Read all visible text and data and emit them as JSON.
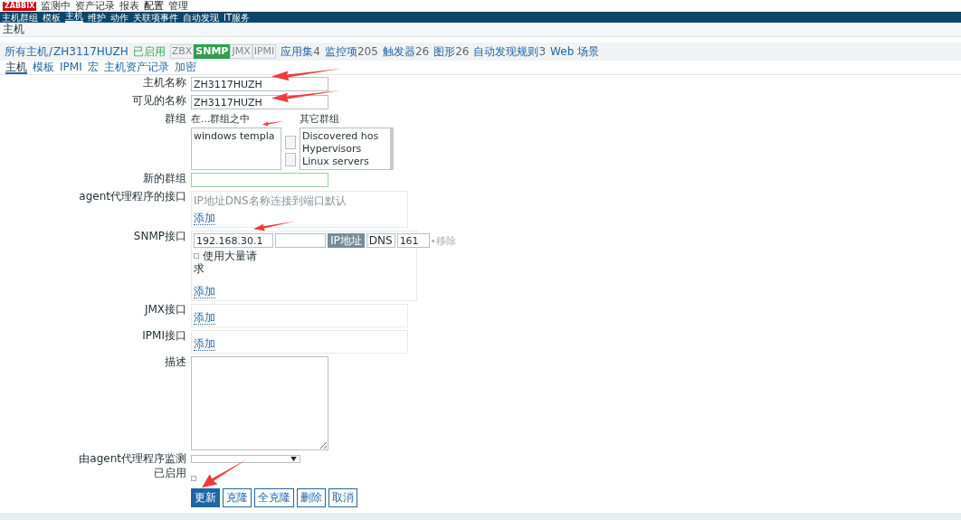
{
  "logo": "ZABBIX",
  "top_menu": [
    {
      "label": "监测中",
      "selected": false
    },
    {
      "label": "资产记录",
      "selected": false
    },
    {
      "label": "报表",
      "selected": false
    },
    {
      "label": "配置",
      "selected": true
    },
    {
      "label": "管理",
      "selected": false
    }
  ],
  "sub_menu": [
    {
      "label": "主机群组",
      "selected": false
    },
    {
      "label": "模板",
      "selected": false
    },
    {
      "label": "主机",
      "selected": true
    },
    {
      "label": "维护",
      "selected": false
    },
    {
      "label": "动作",
      "selected": false
    },
    {
      "label": "关联项事件",
      "selected": false
    },
    {
      "label": "自动发现",
      "selected": false
    },
    {
      "label": "IT服务",
      "selected": false
    }
  ],
  "page_title": "主机",
  "breadcrumb": {
    "all_hosts": "所有主机",
    "separator": "/",
    "host": "ZH3117HUZH",
    "status": "已启用",
    "availability": [
      {
        "label": "ZBX",
        "on": false
      },
      {
        "label": "SNMP",
        "on": true
      },
      {
        "label": "JMX",
        "on": false
      },
      {
        "label": "IPMI",
        "on": false
      }
    ],
    "links": [
      {
        "label": "应用集",
        "count": "4"
      },
      {
        "label": "监控项",
        "count": "205"
      },
      {
        "label": "触发器",
        "count": "26"
      },
      {
        "label": "图形",
        "count": "26"
      },
      {
        "label": "自动发现规则",
        "count": "3"
      },
      {
        "label": "Web 场景"
      }
    ]
  },
  "tabs": [
    {
      "label": "主机",
      "selected": true
    },
    {
      "label": "模板",
      "selected": false
    },
    {
      "label": "IPMI",
      "selected": false
    },
    {
      "label": "宏",
      "selected": false
    },
    {
      "label": "主机资产记录",
      "selected": false
    },
    {
      "label": "加密",
      "selected": false
    }
  ],
  "form": {
    "host_name": {
      "label": "主机名称",
      "value": "ZH3117HUZH"
    },
    "visible_name": {
      "label": "可见的名称",
      "value": "ZH3117HUZH"
    },
    "groups": {
      "label": "群组",
      "in_groups_title": "在...群组之中",
      "in_groups": [
        "windows templa"
      ],
      "other_groups_title": "其它群组",
      "other_groups": [
        "Discovered hos",
        "Hypervisors",
        "Linux servers"
      ]
    },
    "new_group": {
      "label": "新的群组"
    },
    "agent_interfaces": {
      "label": "agent代理程序的接口",
      "header": "IP地址DNS名称连接到端口默认",
      "add": "添加"
    },
    "snmp_interfaces": {
      "label": "SNMP接口",
      "ip": "192.168.30.1",
      "connect_ip": "IP地址",
      "connect_dns": "DNS",
      "port": "161",
      "remove": "移除",
      "bulk": "使用大量请",
      "bulk_wrap": "求",
      "bulk_checked": false,
      "add": "添加"
    },
    "jmx_interfaces": {
      "label": "JMX接口",
      "add": "添加"
    },
    "ipmi_interfaces": {
      "label": "IPMI接口",
      "add": "添加"
    },
    "description": {
      "label": "描述"
    },
    "proxy": {
      "label": "由agent代理程序监测"
    },
    "enabled": {
      "label": "已启用",
      "checked": false
    }
  },
  "buttons": [
    {
      "label": "更新",
      "kind": "primary"
    },
    {
      "label": "克隆",
      "kind": "normal"
    },
    {
      "label": "全克隆",
      "kind": "normal"
    },
    {
      "label": "删除",
      "kind": "normal"
    },
    {
      "label": "取消",
      "kind": "normal"
    }
  ]
}
